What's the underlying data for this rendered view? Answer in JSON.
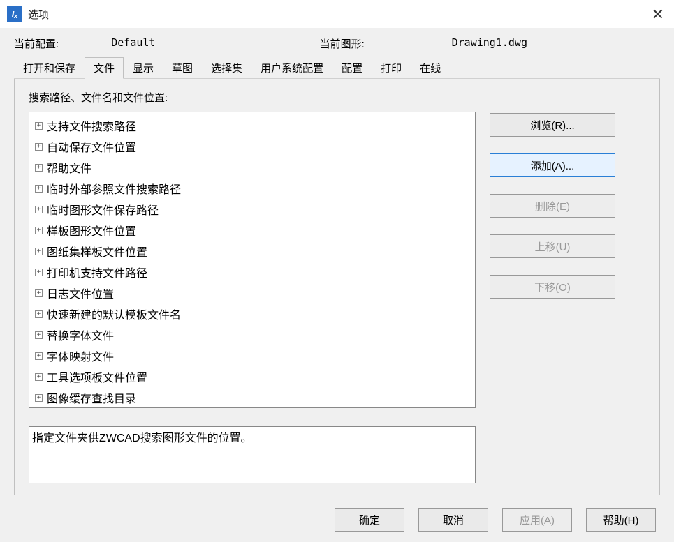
{
  "window": {
    "title": "选项"
  },
  "config": {
    "current_profile_label": "当前配置:",
    "current_profile_value": "Default",
    "current_drawing_label": "当前图形:",
    "current_drawing_value": "Drawing1.dwg"
  },
  "tabs": [
    {
      "label": "打开和保存"
    },
    {
      "label": "文件"
    },
    {
      "label": "显示"
    },
    {
      "label": "草图"
    },
    {
      "label": "选择集"
    },
    {
      "label": "用户系统配置"
    },
    {
      "label": "配置"
    },
    {
      "label": "打印"
    },
    {
      "label": "在线"
    }
  ],
  "section_label": "搜索路径、文件名和文件位置:",
  "tree": [
    {
      "label": "支持文件搜索路径"
    },
    {
      "label": "自动保存文件位置"
    },
    {
      "label": "帮助文件"
    },
    {
      "label": "临时外部参照文件搜索路径"
    },
    {
      "label": "临时图形文件保存路径"
    },
    {
      "label": "样板图形文件位置"
    },
    {
      "label": "图纸集样板文件位置"
    },
    {
      "label": "打印机支持文件路径"
    },
    {
      "label": "日志文件位置"
    },
    {
      "label": "快速新建的默认模板文件名"
    },
    {
      "label": "替换字体文件"
    },
    {
      "label": "字体映射文件"
    },
    {
      "label": "工具选项板文件位置"
    },
    {
      "label": "图像缓存查找目录"
    }
  ],
  "side_buttons": {
    "browse": "浏览(R)...",
    "add": "添加(A)...",
    "delete": "删除(E)",
    "moveup": "上移(U)",
    "movedown": "下移(O)"
  },
  "description": "指定文件夹供ZWCAD搜索图形文件的位置。",
  "footer": {
    "ok": "确定",
    "cancel": "取消",
    "apply": "应用(A)",
    "help": "帮助(H)"
  }
}
